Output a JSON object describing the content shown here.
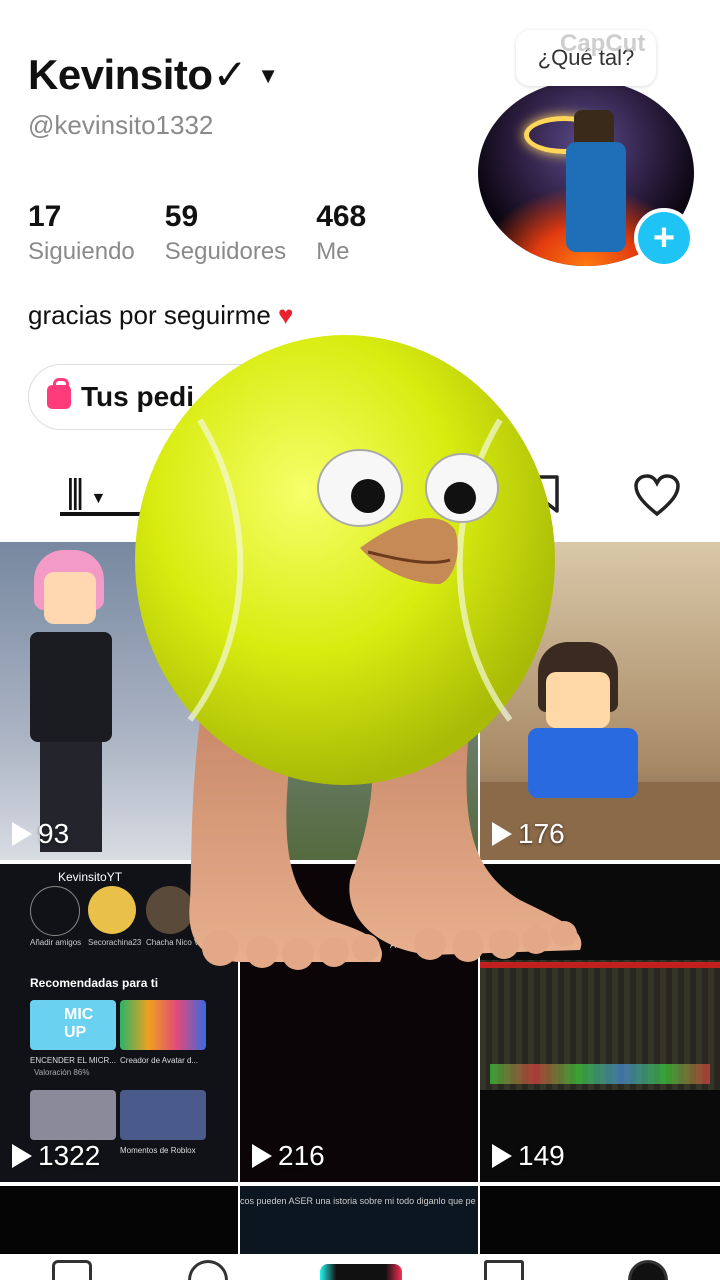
{
  "profile": {
    "name": "Kevinsito✓",
    "handle": "@kevinsito1332",
    "bio": "gracias por seguirme",
    "bio_emoji": "♥",
    "stats": [
      {
        "count": "17",
        "label": "Siguiendo"
      },
      {
        "count": "59",
        "label": "Seguidores"
      },
      {
        "count": "468",
        "label": "Me"
      }
    ],
    "orders_button": "Tus pedi"
  },
  "overlay": {
    "capcut_bubble": "¿Qué tal?",
    "capcut_watermark": "CapCut"
  },
  "tabs": {
    "videos_icon": "grid-icon",
    "saved_icon": "bookmark-icon",
    "liked_icon": "heart-icon"
  },
  "videos": [
    {
      "views": "93"
    },
    {
      "views": ""
    },
    {
      "views": "176"
    },
    {
      "views": "1322",
      "inner": {
        "header": "KevinsitoYT",
        "friends": [
          "Añadir amigos",
          "Secorachina23 Breakhouse...",
          "Chacha Nico Vacios..."
        ],
        "recommended": "Recomendadas para ti",
        "games": [
          "ENCENDER EL MICR...",
          "Creador de Avatar d...",
          "Momentos de Roblox"
        ],
        "mic_up": "MIC UP",
        "rating": "Valoración 86%"
      }
    },
    {
      "views": "216",
      "caption": "ASER u..."
    },
    {
      "views": "149"
    }
  ],
  "bottom_row_caption": "cos pueden ASER una istoria sobre mi todo diganlo que pe",
  "colors": {
    "accent": "#20c4f4",
    "heart": "#e8232f",
    "bag": "#ff3b7b"
  }
}
